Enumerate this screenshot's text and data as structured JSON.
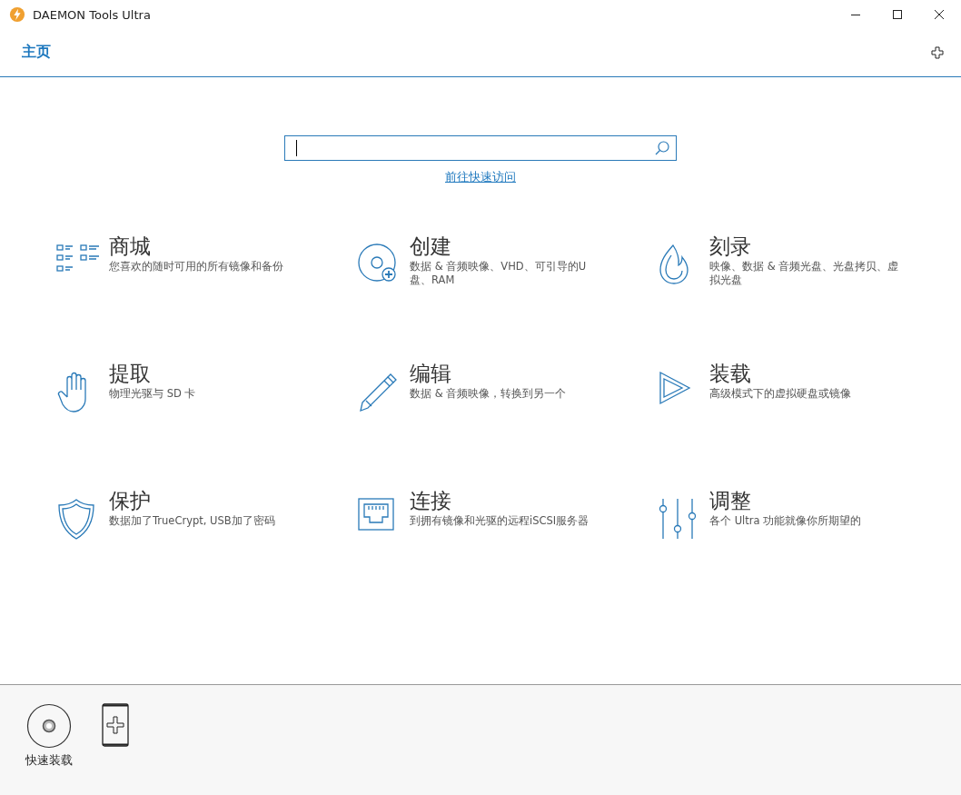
{
  "window": {
    "title": "DAEMON Tools Ultra"
  },
  "tabs": [
    {
      "label": "主页",
      "selected": true
    }
  ],
  "search": {
    "link": "前往快速访问"
  },
  "tiles": [
    {
      "title": "商城",
      "description": "您喜欢的随时可用的所有镜像和备份"
    },
    {
      "title": "创建",
      "description": "数据 & 音频映像、VHD、可引导的U盘、RAM"
    },
    {
      "title": "刻录",
      "description": "映像、数据 & 音频光盘、光盘拷贝、虚拟光盘"
    },
    {
      "title": "提取",
      "description": "物理光驱与 SD 卡"
    },
    {
      "title": "编辑",
      "description": "数据 & 音频映像，转换到另一个"
    },
    {
      "title": "装载",
      "description": "高级模式下的虚拟硬盘或镜像"
    },
    {
      "title": "保护",
      "description": "数据加了TrueCrypt, USB加了密码"
    },
    {
      "title": "连接",
      "description": "到拥有镜像和光驱的远程iSCSI服务器"
    },
    {
      "title": "调整",
      "description": "各个 Ultra 功能就像你所期望的"
    }
  ],
  "dock": [
    {
      "kind": "disc",
      "label": "快速装载"
    },
    {
      "kind": "add-device"
    }
  ]
}
